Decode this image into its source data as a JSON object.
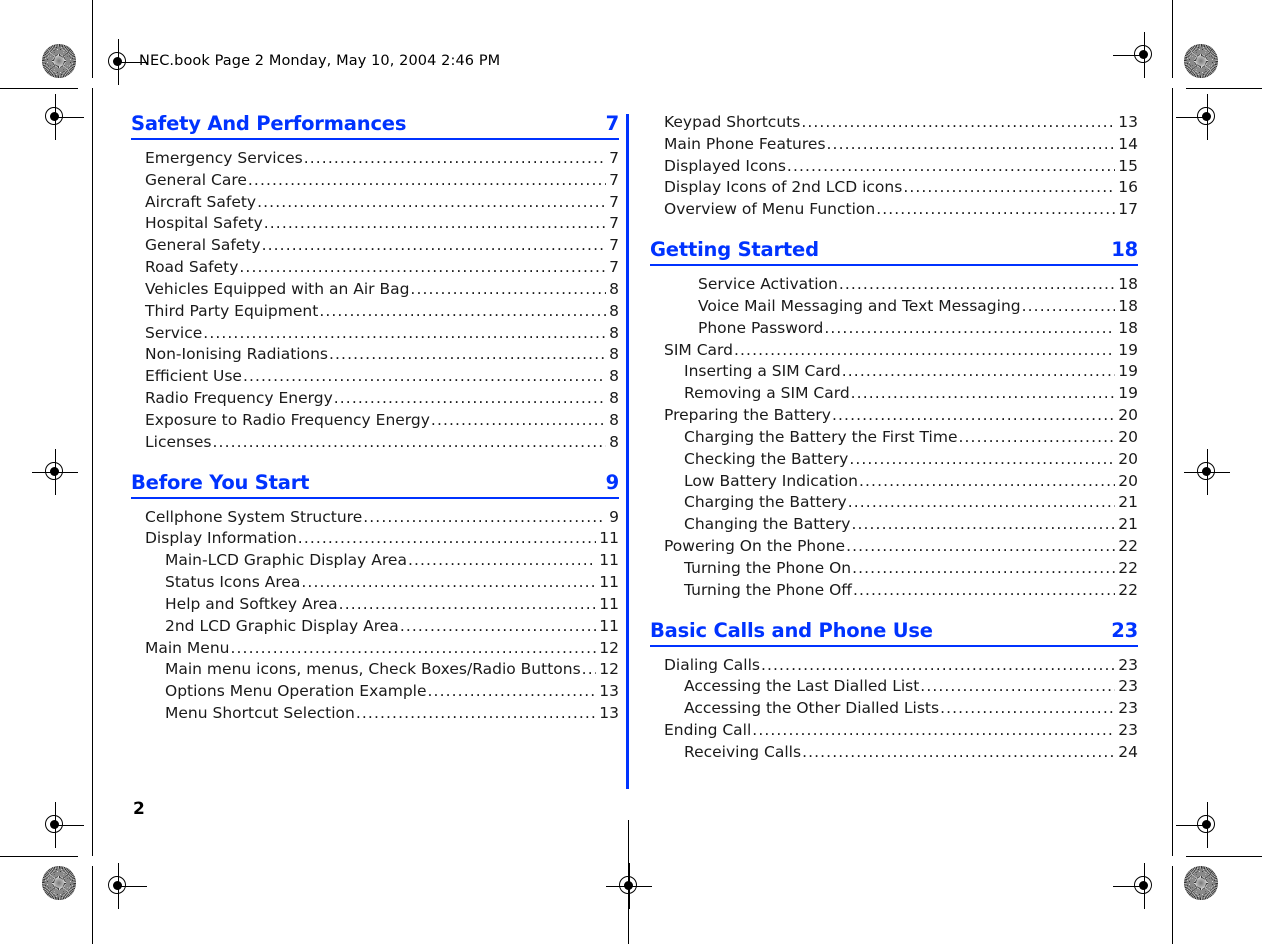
{
  "document": {
    "file_slug": "NEC.book  Page 2  Monday, May 10, 2004  2:46 PM",
    "folio": "2",
    "accent_color": "#0033ff",
    "text_color": "#1a1a1a"
  },
  "columns": {
    "left": [
      {
        "type": "section",
        "title": "Safety And Performances",
        "page": "7",
        "entries": [
          {
            "level": 1,
            "label": "Emergency Services",
            "page": "7"
          },
          {
            "level": 1,
            "label": "General Care",
            "page": "7"
          },
          {
            "level": 1,
            "label": "Aircraft Safety",
            "page": "7"
          },
          {
            "level": 1,
            "label": "Hospital Safety",
            "page": "7"
          },
          {
            "level": 1,
            "label": "General Safety",
            "page": "7"
          },
          {
            "level": 1,
            "label": "Road Safety",
            "page": "7"
          },
          {
            "level": 1,
            "label": "Vehicles Equipped with an Air Bag",
            "page": "8"
          },
          {
            "level": 1,
            "label": "Third Party Equipment",
            "page": "8"
          },
          {
            "level": 1,
            "label": "Service",
            "page": "8"
          },
          {
            "level": 1,
            "label": "Non-Ionising Radiations",
            "page": "8"
          },
          {
            "level": 1,
            "label": "Efficient Use",
            "page": "8"
          },
          {
            "level": 1,
            "label": "Radio Frequency Energy",
            "page": "8"
          },
          {
            "level": 1,
            "label": "Exposure to Radio Frequency Energy",
            "page": "8"
          },
          {
            "level": 1,
            "label": "Licenses",
            "page": "8"
          }
        ]
      },
      {
        "type": "section",
        "title": "Before You Start",
        "page": "9",
        "entries": [
          {
            "level": 1,
            "label": "Cellphone System Structure",
            "page": "9"
          },
          {
            "level": 1,
            "label": "Display Information",
            "page": "11"
          },
          {
            "level": 2,
            "label": "Main-LCD Graphic Display Area",
            "page": "11"
          },
          {
            "level": 2,
            "label": "Status Icons Area",
            "page": "11"
          },
          {
            "level": 2,
            "label": "Help and Softkey Area",
            "page": "11"
          },
          {
            "level": 2,
            "label": "2nd LCD Graphic Display Area",
            "page": "11"
          },
          {
            "level": 1,
            "label": "Main Menu",
            "page": "12"
          },
          {
            "level": 2,
            "label": "Main menu icons, menus, Check Boxes/Radio Buttons",
            "page": "12"
          },
          {
            "level": 2,
            "label": "Options Menu Operation Example",
            "page": "13"
          },
          {
            "level": 2,
            "label": "Menu Shortcut Selection",
            "page": "13"
          }
        ]
      }
    ],
    "right": [
      {
        "type": "continuation",
        "entries": [
          {
            "level": 1,
            "label": "Keypad Shortcuts",
            "page": "13"
          },
          {
            "level": 1,
            "label": "Main Phone Features",
            "page": "14"
          },
          {
            "level": 1,
            "label": "Displayed Icons",
            "page": "15"
          },
          {
            "level": 1,
            "label": "Display Icons of 2nd LCD icons",
            "page": "16"
          },
          {
            "level": 1,
            "label": "Overview of Menu Function",
            "page": "17"
          }
        ]
      },
      {
        "type": "section",
        "title": "Getting Started",
        "page": "18",
        "entries": [
          {
            "level": 3,
            "label": "Service Activation",
            "page": "18"
          },
          {
            "level": 3,
            "label": "Voice Mail Messaging and Text Messaging",
            "page": "18"
          },
          {
            "level": 3,
            "label": "Phone Password",
            "page": "18"
          },
          {
            "level": 1,
            "label": "SIM Card",
            "page": "19"
          },
          {
            "level": 2,
            "label": "Inserting a SIM Card",
            "page": "19"
          },
          {
            "level": 2,
            "label": "Removing a SIM Card",
            "page": "19"
          },
          {
            "level": 1,
            "label": "Preparing the Battery",
            "page": "20"
          },
          {
            "level": 2,
            "label": "Charging the Battery the First Time",
            "page": "20"
          },
          {
            "level": 2,
            "label": "Checking the Battery",
            "page": "20"
          },
          {
            "level": 2,
            "label": "Low Battery Indication",
            "page": "20"
          },
          {
            "level": 2,
            "label": "Charging the Battery",
            "page": "21"
          },
          {
            "level": 2,
            "label": "Changing the Battery",
            "page": "21"
          },
          {
            "level": 1,
            "label": "Powering On the Phone",
            "page": "22"
          },
          {
            "level": 2,
            "label": "Turning the Phone On",
            "page": "22"
          },
          {
            "level": 2,
            "label": "Turning the Phone Off",
            "page": "22"
          }
        ]
      },
      {
        "type": "section",
        "title": "Basic Calls and Phone Use",
        "page": "23",
        "entries": [
          {
            "level": 1,
            "label": "Dialing Calls",
            "page": "23"
          },
          {
            "level": 2,
            "label": "Accessing the Last Dialled List",
            "page": "23"
          },
          {
            "level": 2,
            "label": "Accessing the Other Dialled Lists",
            "page": "23"
          },
          {
            "level": 1,
            "label": "Ending Call",
            "page": "23"
          },
          {
            "level": 2,
            "label": "Receiving Calls",
            "page": "24"
          }
        ]
      }
    ]
  }
}
